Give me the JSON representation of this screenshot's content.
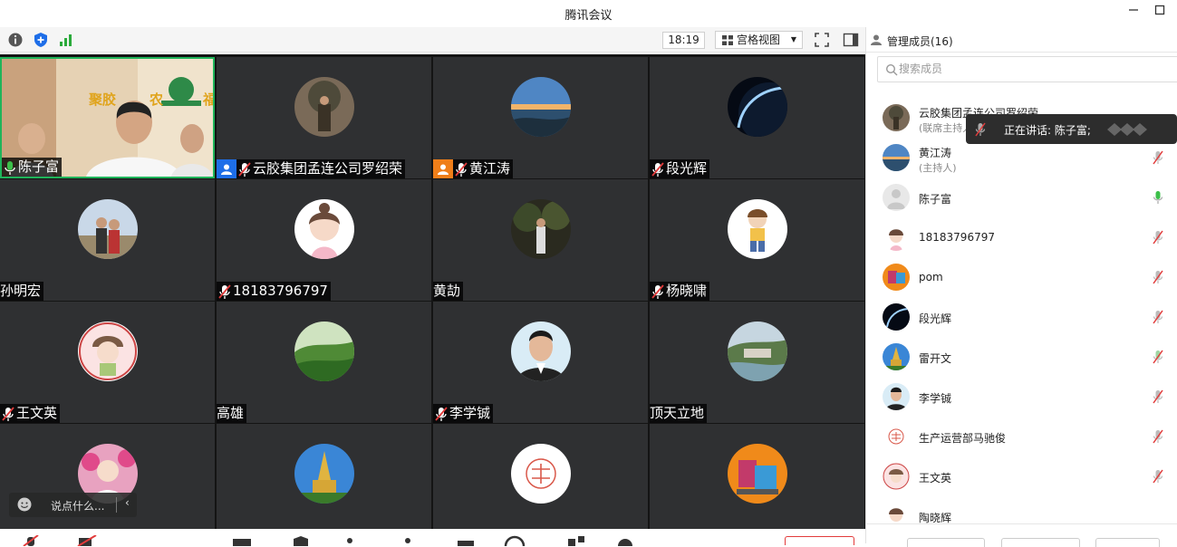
{
  "window": {
    "title": "腾讯会议"
  },
  "toolbar": {
    "time": "18:19",
    "view_label": "宫格视图"
  },
  "tiles": [
    {
      "name": "陈子富",
      "mic": "on",
      "role": "",
      "avatar": "video"
    },
    {
      "name": "云胶集团孟连公司罗绍荣",
      "mic": "muted",
      "role": "host",
      "avatar": "photo-tree"
    },
    {
      "name": "黄江涛",
      "mic": "muted",
      "role": "cohost",
      "avatar": "photo-sea"
    },
    {
      "name": "段光辉",
      "mic": "muted",
      "role": "",
      "avatar": "photo-planet"
    },
    {
      "name": "孙明宏",
      "mic": "none",
      "role": "",
      "avatar": "photo-couple"
    },
    {
      "name": "18183796797",
      "mic": "muted",
      "role": "",
      "avatar": "photo-girl-cartoon"
    },
    {
      "name": "黄劼",
      "mic": "none",
      "role": "",
      "avatar": "photo-forest"
    },
    {
      "name": "杨晓啸",
      "mic": "muted",
      "role": "",
      "avatar": "photo-boy-cartoon"
    },
    {
      "name": "王文英",
      "mic": "muted",
      "role": "",
      "avatar": "photo-girl-hat"
    },
    {
      "name": "高雄",
      "mic": "none",
      "role": "",
      "avatar": "photo-hills"
    },
    {
      "name": "李学铖",
      "mic": "muted",
      "role": "",
      "avatar": "photo-man"
    },
    {
      "name": "顶天立地",
      "mic": "none",
      "role": "",
      "avatar": "photo-village"
    },
    {
      "name": "",
      "mic": "none",
      "role": "",
      "avatar": "photo-girl-flowers"
    },
    {
      "name": "",
      "mic": "none",
      "role": "",
      "avatar": "photo-pagoda"
    },
    {
      "name": "",
      "mic": "none",
      "role": "",
      "avatar": "logo-zhongguo"
    },
    {
      "name": "",
      "mic": "none",
      "role": "",
      "avatar": "photo-cart"
    }
  ],
  "video_overlay": {
    "sign_left": "聚胶",
    "sign_mid": "农",
    "sign_right": "福"
  },
  "chat": {
    "placeholder": "说点什么..."
  },
  "panel": {
    "title": "管理成员(16)",
    "search_placeholder": "搜索成员",
    "speaking_text": "正在讲话: 陈子富;",
    "members": [
      {
        "name": "云胶集团孟连公司罗绍荣",
        "role": "(联席主持人)",
        "mic": "muted",
        "avatar": "photo-tree"
      },
      {
        "name": "黄江涛",
        "role": "(主持人)",
        "mic": "muted",
        "avatar": "photo-sea"
      },
      {
        "name": "陈子富",
        "role": "",
        "mic": "on",
        "avatar": "default"
      },
      {
        "name": "18183796797",
        "role": "",
        "mic": "muted",
        "avatar": "photo-girl-cartoon"
      },
      {
        "name": "pom",
        "role": "",
        "mic": "muted",
        "avatar": "photo-orange"
      },
      {
        "name": "段光辉",
        "role": "",
        "mic": "muted",
        "avatar": "photo-planet"
      },
      {
        "name": "雷开文",
        "role": "",
        "mic": "muted-green",
        "avatar": "photo-pagoda"
      },
      {
        "name": "李学铖",
        "role": "",
        "mic": "muted",
        "avatar": "photo-man"
      },
      {
        "name": "生产运营部马驰俊",
        "role": "",
        "mic": "muted",
        "avatar": "logo-zhongguo"
      },
      {
        "name": "王文英",
        "role": "",
        "mic": "muted",
        "avatar": "photo-girl-hat"
      },
      {
        "name": "陶晓辉",
        "role": "",
        "mic": "none",
        "avatar": "photo-girl-cartoon"
      }
    ]
  },
  "colors": {
    "active_border": "#1fb45a",
    "host_badge": "#1e6ee8",
    "cohost_badge": "#ef7e19",
    "mute_red": "#e23b3b",
    "mic_green": "#3cbf4a"
  }
}
